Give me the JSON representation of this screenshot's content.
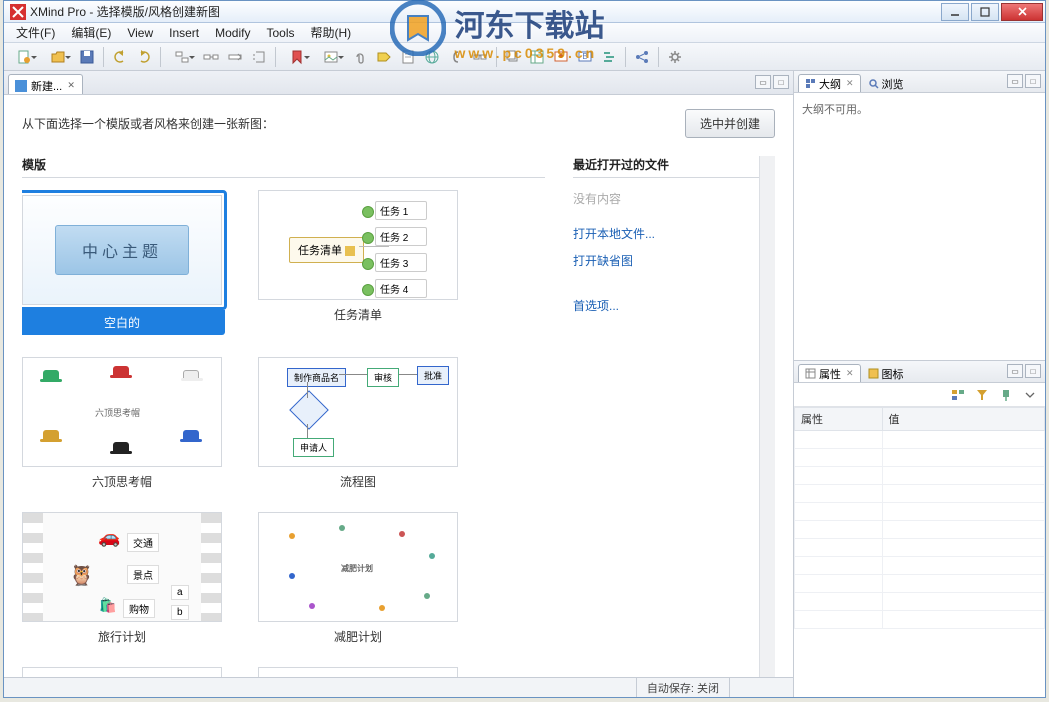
{
  "watermark": {
    "cn": "河东下载站",
    "url": "www.pc0359.cn"
  },
  "titlebar": {
    "title": "XMind Pro - 选择模版/风格创建新图"
  },
  "menubar": [
    "文件(F)",
    "编辑(E)",
    "View",
    "Insert",
    "Modify",
    "Tools",
    "帮助(H)"
  ],
  "tabs": {
    "new": "新建..."
  },
  "panel": {
    "instruction": "从下面选择一个模版或者风格来创建一张新图：",
    "create_btn": "选中并创建",
    "templates_title": "模版",
    "recent_title": "最近打开过的文件",
    "recent_empty": "没有内容",
    "recent_links": [
      "打开本地文件...",
      "打开缺省图"
    ],
    "pref_link": "首选项..."
  },
  "templates": [
    {
      "label": "空白的",
      "center": "中心主题",
      "selected": true,
      "kind": "blank"
    },
    {
      "label": "任务清单",
      "main": "任务清单",
      "subs": [
        "任务 1",
        "任务 2",
        "任务 3",
        "任务 4"
      ],
      "kind": "task"
    },
    {
      "label": "六顶思考帽",
      "kind": "hats",
      "center_text": "六顶思考帽"
    },
    {
      "label": "流程图",
      "kind": "flow",
      "nodes": [
        "制作商品名",
        "审核",
        "申请人",
        "批准"
      ]
    },
    {
      "label": "旅行计划",
      "kind": "trip",
      "labels": [
        "交通",
        "景点",
        "购物",
        "a",
        "b"
      ]
    },
    {
      "label": "减肥计划",
      "kind": "diet",
      "center": "减肥计划"
    }
  ],
  "right": {
    "outline_tab": "大纲",
    "browse_tab": "浏览",
    "outline_msg": "大纲不可用。",
    "props_tab": "属性",
    "icons_tab": "图标",
    "prop_col": "属性",
    "val_col": "值"
  },
  "status": {
    "autosave": "自动保存: 关闭"
  }
}
